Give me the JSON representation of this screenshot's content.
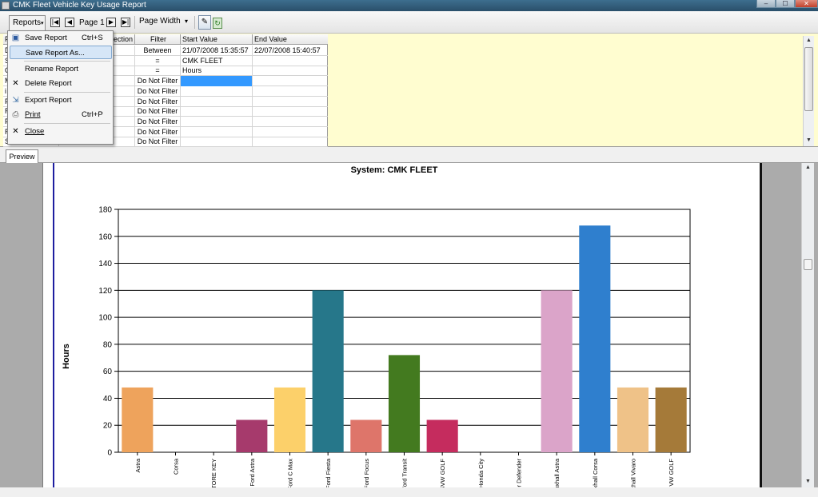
{
  "window": {
    "title": "CMK Fleet Vehicle Key Usage Report",
    "controls": {
      "minimize": "–",
      "maximize": "☐",
      "close": "✕"
    }
  },
  "toolbar": {
    "reports_label": "Reports",
    "page_label": "Page 1",
    "zoom_value": "Page Width"
  },
  "menu": {
    "items": [
      {
        "label": "Save Report",
        "shortcut": "Ctrl+S",
        "icon": "save-icon"
      },
      {
        "label": "Save Report As...",
        "shortcut": "",
        "icon": ""
      },
      {
        "label": "Rename Report",
        "shortcut": "",
        "icon": ""
      },
      {
        "label": "Delete Report",
        "shortcut": "",
        "icon": "delete-x-icon"
      },
      {
        "label": "Export Report",
        "shortcut": "",
        "icon": "export-icon"
      },
      {
        "label": "Print",
        "shortcut": "Ctrl+P",
        "icon": "printer-icon"
      },
      {
        "label": "Close",
        "shortcut": "",
        "icon": "close-x-icon"
      }
    ]
  },
  "criteria": {
    "headers": {
      "field": "F",
      "direction": "ection",
      "filter": "Filter",
      "start": "Start Value",
      "end": "End Value"
    },
    "rows": [
      {
        "field": "D",
        "direction": "",
        "filter": "Between",
        "start": "21/07/2008 15:35:57",
        "end": "22/07/2008 15:40:57"
      },
      {
        "field": "S",
        "direction": "",
        "filter": "=",
        "start": "CMK FLEET",
        "end": ""
      },
      {
        "field": "C",
        "direction": "",
        "filter": "=",
        "start": "Hours",
        "end": ""
      },
      {
        "field": "M",
        "direction": "",
        "filter": "Do Not Filter",
        "start": "",
        "end": ""
      },
      {
        "field": "i",
        "direction": "",
        "filter": "Do Not Filter",
        "start": "",
        "end": ""
      },
      {
        "field": "F",
        "direction": "",
        "filter": "Do Not Filter",
        "start": "",
        "end": ""
      },
      {
        "field": "R",
        "direction": "",
        "filter": "Do Not Filter",
        "start": "",
        "end": ""
      },
      {
        "field": "F",
        "direction": "",
        "filter": "Do Not Filter",
        "start": "",
        "end": ""
      },
      {
        "field": "R",
        "direction": "",
        "filter": "Do Not Filter",
        "start": "",
        "end": ""
      },
      {
        "field": "S",
        "direction": "",
        "filter": "Do Not Filter",
        "start": "",
        "end": ""
      }
    ]
  },
  "tabs": {
    "preview_label": "Preview"
  },
  "colors": {
    "criteria_background": "#fffdd0",
    "selected_cell": "#3399ff",
    "menu_highlight": "#d6e6f7"
  },
  "chart_data": {
    "type": "bar",
    "title": "System: CMK FLEET",
    "xlabel": "",
    "ylabel": "Hours",
    "ylim": [
      0,
      180
    ],
    "yticks": [
      0,
      20,
      40,
      60,
      80,
      100,
      120,
      140,
      160,
      180
    ],
    "grid": true,
    "categories": [
      "Astra",
      "Corsa",
      "TORE KEY",
      "Ford Astra",
      "Ford C Max",
      "Ford Fiesta",
      "Ford Focus",
      "ford Transit",
      "SVW GOLF",
      "Honda City",
      "er Defender",
      "uxhall Astra",
      "uxhall Corsa",
      "uxhall Vivaro",
      "VW GOLF"
    ],
    "values": [
      48,
      0,
      0,
      24,
      48,
      120,
      24,
      72,
      24,
      0,
      0,
      120,
      168,
      48,
      48
    ],
    "bar_colors": [
      "#eea35c",
      "#cccccc",
      "#cccccc",
      "#a63a6c",
      "#fcd06a",
      "#26778a",
      "#de756a",
      "#437a1f",
      "#c52c5e",
      "#cccccc",
      "#cccccc",
      "#dba4c9",
      "#2f7fce",
      "#efc288",
      "#a57a39"
    ]
  }
}
